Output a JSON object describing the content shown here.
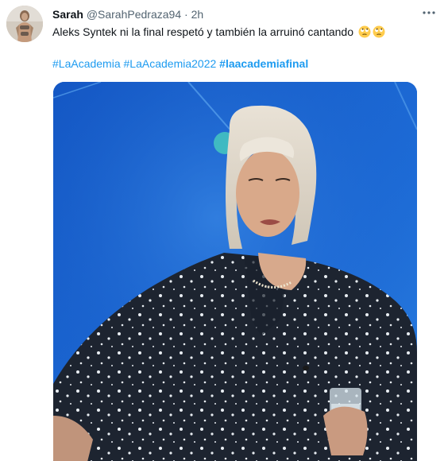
{
  "tweet": {
    "author_name": "Sarah",
    "author_handle": "@SarahPedraza94",
    "separator": "·",
    "time": "2h",
    "text": "Aleks Syntek ni la final respetó y también la arruinó cantando",
    "emojis": [
      "face-with-rolling-eyes-icon",
      "face-with-rolling-eyes-icon"
    ],
    "hashtags": [
      "#LaAcademia",
      "#LaAcademia2022",
      "#laacademiafinal"
    ]
  },
  "colors": {
    "link": "#1d9bf0",
    "text": "#0f1419",
    "secondary": "#536471"
  }
}
